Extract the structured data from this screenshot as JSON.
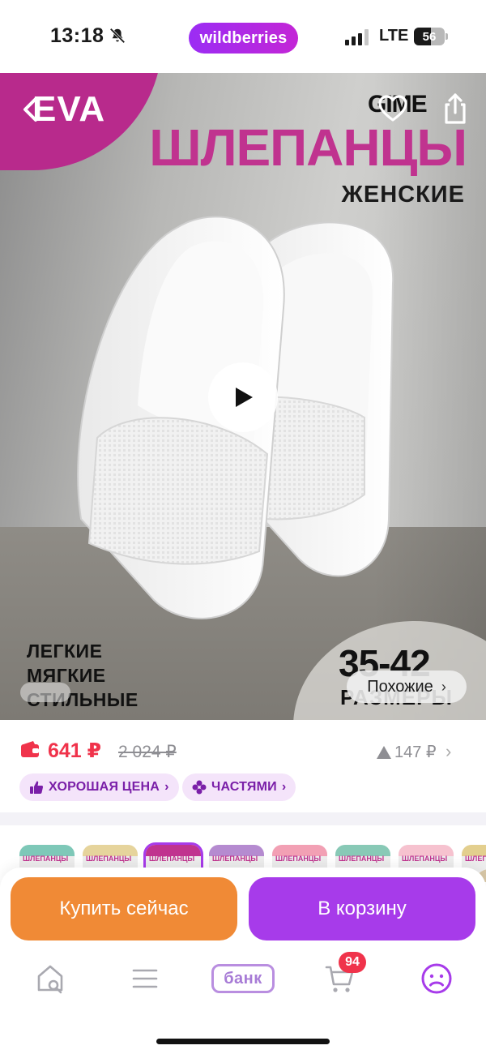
{
  "status_bar": {
    "time": "13:18",
    "app_pill": "wildberries",
    "carrier": "LTE",
    "battery": "56",
    "battery_level": 0.56,
    "icons": [
      "bell-off-icon",
      "signal-icon",
      "battery-icon"
    ]
  },
  "hero": {
    "brand": "EVA",
    "logo": "GIME",
    "title": "ШЛЕПАНЦЫ",
    "subtitle": "ЖЕНСКИЕ",
    "features": [
      "ЛЕГКИЕ",
      "МЯГКИЕ",
      "СТИЛЬНЫЕ"
    ],
    "sizes": "35-42",
    "sizes_label": "РАЗМЕРЫ",
    "similar_label": "Похожие",
    "icons": [
      "back-icon",
      "favorite-icon",
      "share-icon",
      "play-icon"
    ]
  },
  "price": {
    "current": "641 ₽",
    "old": "2 024 ₽",
    "drop": "147 ₽",
    "tags": [
      {
        "label": "ХОРОШАЯ ЦЕНА",
        "icon": "thumbs-up-icon"
      },
      {
        "label": "ЧАСТЯМИ",
        "icon": "parts-icon"
      }
    ]
  },
  "colors": {
    "thumb_label": "ШЛЕПАНЦЫ",
    "variants": [
      {
        "shoe": "#f4f4f4",
        "band": "#7ec8b8"
      },
      {
        "shoe": "#f1e6c8",
        "band": "#e6d49c"
      },
      {
        "shoe": "#e8e8e8",
        "band": "#c0338f"
      },
      {
        "shoe": "#2a2a2a",
        "band": "#b58bd0"
      },
      {
        "shoe": "#f3c3cd",
        "band": "#f2a0b4"
      },
      {
        "shoe": "#7d7d7d",
        "band": "#88c9b6"
      },
      {
        "shoe": "#f5d6dc",
        "band": "#f6c2cf"
      },
      {
        "shoe": "#d8c7a6",
        "band": "#e3cf8e"
      }
    ],
    "selected_index": 2
  },
  "actions": {
    "buy_now": "Купить сейчас",
    "add_to_cart": "В корзину"
  },
  "tab_bar": {
    "bank": "банк",
    "cart_count": "94",
    "icons": [
      "home-search-icon",
      "menu-icon",
      "bank-icon",
      "cart-icon",
      "profile-icon"
    ]
  },
  "colors_theme": {
    "accent": "#a73bea",
    "buy_now": "#f08a36",
    "price": "#f0334b",
    "brand_pink": "#c0338f"
  }
}
